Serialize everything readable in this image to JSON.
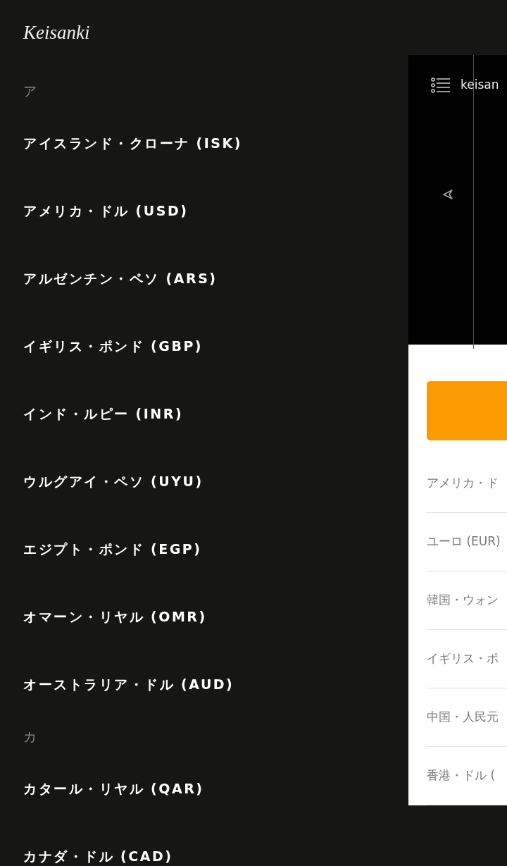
{
  "drawer": {
    "title": "Keisanki",
    "sections": [
      {
        "heading": "ア",
        "items": [
          "アイスランド・クローナ (ISK)",
          "アメリカ・ドル (USD)",
          "アルゼンチン・ペソ (ARS)",
          "イギリス・ポンド (GBP)",
          "インド・ルピー (INR)",
          "ウルグアイ・ペソ (UYU)",
          "エジプト・ポンド (EGP)",
          "オマーン・リヤル (OMR)",
          "オーストラリア・ドル (AUD)"
        ]
      },
      {
        "heading": "カ",
        "items": [
          "カタール・リヤル (QAR)",
          "カナダ・ドル (CAD)"
        ]
      }
    ]
  },
  "background_app": {
    "title": "keisan",
    "currency_rows": [
      "アメリカ・ド",
      "ユーロ (EUR)",
      "韓国・ウォン",
      "イギリス・ポ",
      "中国・人民元",
      "香港・ドル ("
    ]
  }
}
